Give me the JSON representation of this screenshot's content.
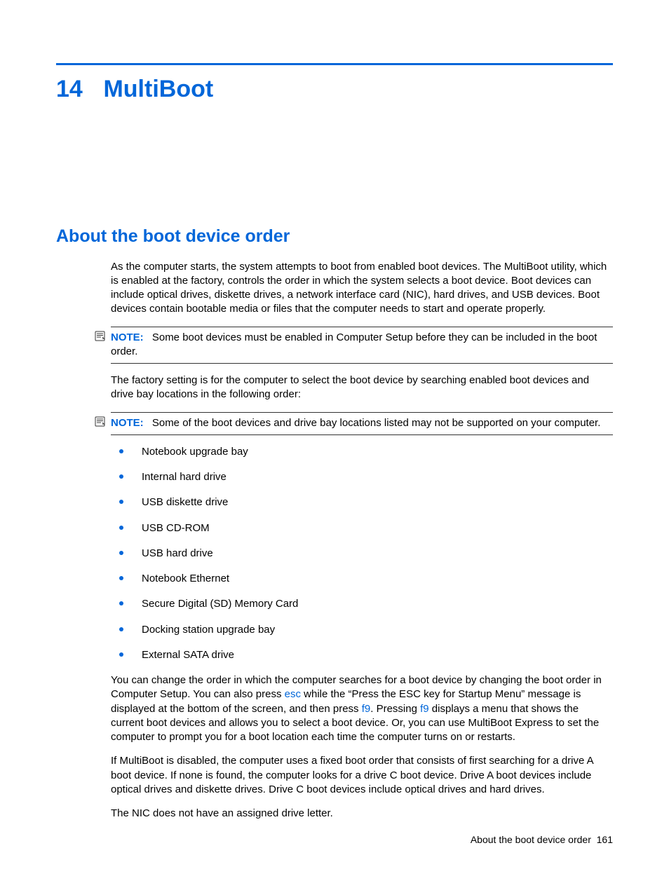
{
  "chapter": {
    "number": "14",
    "title": "MultiBoot"
  },
  "section": {
    "heading": "About the boot device order"
  },
  "para_intro": "As the computer starts, the system attempts to boot from enabled boot devices. The MultiBoot utility, which is enabled at the factory, controls the order in which the system selects a boot device. Boot devices can include optical drives, diskette drives, a network interface card (NIC), hard drives, and USB devices. Boot devices contain bootable media or files that the computer needs to start and operate properly.",
  "note1": {
    "label": "NOTE:",
    "text": "Some boot devices must be enabled in Computer Setup before they can be included in the boot order."
  },
  "para_factory": "The factory setting is for the computer to select the boot device by searching enabled boot devices and drive bay locations in the following order:",
  "note2": {
    "label": "NOTE:",
    "text": "Some of the boot devices and drive bay locations listed may not be supported on your computer."
  },
  "boot_list": [
    "Notebook upgrade bay",
    "Internal hard drive",
    "USB diskette drive",
    "USB CD-ROM",
    "USB hard drive",
    "Notebook Ethernet",
    "Secure Digital (SD) Memory Card",
    "Docking station upgrade bay",
    "External SATA drive"
  ],
  "para_change": {
    "t0": "You can change the order in which the computer searches for a boot device by changing the boot order in Computer Setup. You can also press ",
    "k0": "esc",
    "t1": " while the “Press the ESC key for Startup Menu” message is displayed at the bottom of the screen, and then press ",
    "k1": "f9",
    "t2": ". Pressing ",
    "k2": "f9",
    "t3": " displays a menu that shows the current boot devices and allows you to select a boot device. Or, you can use MultiBoot Express to set the computer to prompt you for a boot location each time the computer turns on or restarts."
  },
  "para_disabled": "If MultiBoot is disabled, the computer uses a fixed boot order that consists of first searching for a drive A boot device. If none is found, the computer looks for a drive C boot device. Drive A boot devices include optical drives and diskette drives. Drive C boot devices include optical drives and hard drives.",
  "para_nic": "The NIC does not have an assigned drive letter.",
  "footer": {
    "section": "About the boot device order",
    "page": "161"
  }
}
